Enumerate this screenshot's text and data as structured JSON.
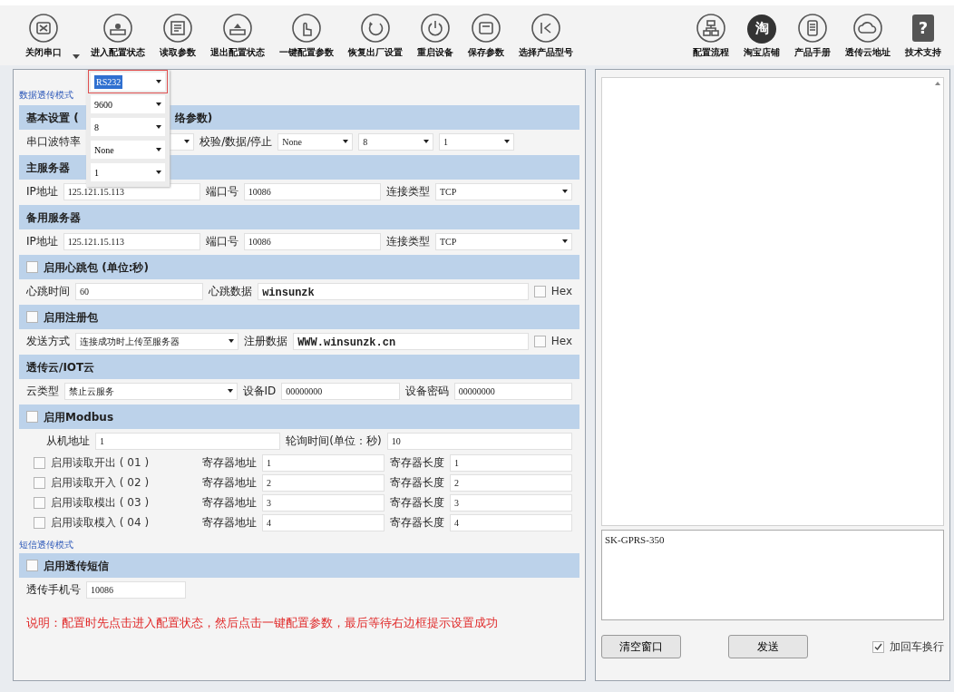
{
  "toolbar_left": [
    {
      "label": "关闭串口"
    },
    {
      "label": "进入配置状态"
    },
    {
      "label": "读取参数"
    },
    {
      "label": "退出配置状态"
    },
    {
      "label": "一键配置参数"
    },
    {
      "label": "恢复出厂设置"
    },
    {
      "label": "重启设备"
    },
    {
      "label": "保存参数"
    },
    {
      "label": "选择产品型号"
    }
  ],
  "toolbar_right": [
    {
      "label": "配置流程"
    },
    {
      "label": "淘宝店铺",
      "glyph": "淘"
    },
    {
      "label": "产品手册"
    },
    {
      "label": "透传云地址"
    },
    {
      "label": "技术支持",
      "glyph": "?"
    }
  ],
  "mode_label": "数据透传模式",
  "popup": {
    "items": [
      {
        "text": "RS232",
        "selected": true
      },
      {
        "text": "9600",
        "selected": false
      },
      {
        "text": "8",
        "selected": false
      },
      {
        "text": "None",
        "selected": false
      },
      {
        "text": "1",
        "selected": false
      }
    ]
  },
  "sections": [
    {
      "title": "基本设置 (",
      "tail": "络参数)",
      "rows": [
        [
          {
            "kind": "label",
            "text": "串口波特率"
          },
          {
            "kind": "combo"
          },
          {
            "kind": "label",
            "text": "校验/数据/停止"
          },
          {
            "kind": "combo",
            "value": "None"
          },
          {
            "kind": "combo",
            "value": "8"
          },
          {
            "kind": "combo",
            "value": "1"
          },
          {
            "kind": "gap"
          }
        ]
      ]
    },
    {
      "title": "主服务器",
      "rows": [
        [
          {
            "kind": "label",
            "text": "IP地址"
          },
          {
            "kind": "input",
            "value": "125.121.15.113"
          },
          {
            "kind": "label",
            "text": "端口号"
          },
          {
            "kind": "input",
            "value": "10086"
          },
          {
            "kind": "label",
            "text": "连接类型"
          },
          {
            "kind": "combo",
            "value": "TCP"
          }
        ]
      ]
    },
    {
      "title": "备用服务器",
      "rows": [
        [
          {
            "kind": "label",
            "text": "IP地址"
          },
          {
            "kind": "input",
            "value": "125.121.15.113"
          },
          {
            "kind": "label",
            "text": "端口号"
          },
          {
            "kind": "input",
            "value": "10086"
          },
          {
            "kind": "label",
            "text": "连接类型"
          },
          {
            "kind": "combo",
            "value": "TCP"
          }
        ]
      ]
    },
    {
      "title": "启用心跳包 (单位:秒)",
      "checked": false,
      "rows": [
        [
          {
            "kind": "label",
            "text": "心跳时间"
          },
          {
            "kind": "input",
            "value": "60"
          },
          {
            "kind": "label",
            "text": "心跳数据"
          },
          {
            "kind": "code_input",
            "value": "winsunzk"
          },
          {
            "kind": "check",
            "text": "Hex",
            "checked": false
          }
        ]
      ]
    },
    {
      "title": "启用注册包",
      "checked": false,
      "rows": [
        [
          {
            "kind": "label",
            "text": "发送方式"
          },
          {
            "kind": "combo",
            "value": "连接成功时上传至服务器"
          },
          {
            "kind": "label",
            "text": "注册数据"
          },
          {
            "kind": "code_input",
            "value": "WWW.winsunzk.cn"
          },
          {
            "kind": "check",
            "text": "Hex",
            "checked": false
          }
        ]
      ]
    },
    {
      "title": "透传云/IOT云",
      "rows": [
        [
          {
            "kind": "label",
            "text": "云类型"
          },
          {
            "kind": "combo",
            "value": "禁止云服务"
          },
          {
            "kind": "label",
            "text": "设备ID"
          },
          {
            "kind": "input",
            "value": "00000000"
          },
          {
            "kind": "label",
            "text": "设备密码"
          },
          {
            "kind": "input",
            "value": "00000000"
          }
        ]
      ]
    },
    {
      "title": "启用Modbus",
      "checked": false,
      "rows": [
        [
          {
            "kind": "label",
            "text": "从机地址"
          },
          {
            "kind": "input",
            "value": "1"
          },
          {
            "kind": "label",
            "text": "轮询时间(单位：秒)"
          },
          {
            "kind": "input",
            "value": "10"
          }
        ]
      ],
      "registers": [
        {
          "label": "启用读取开出 ( 01 )",
          "checked": false,
          "address_label": "寄存器地址",
          "address": "1",
          "length_label": "寄存器长度",
          "length": "1"
        },
        {
          "label": "启用读取开入 ( 02 )",
          "checked": false,
          "address_label": "寄存器地址",
          "address": "2",
          "length_label": "寄存器长度",
          "length": "2"
        },
        {
          "label": "启用读取模出 ( 03 )",
          "checked": false,
          "address_label": "寄存器地址",
          "address": "3",
          "length_label": "寄存器长度",
          "length": "3"
        },
        {
          "label": "启用读取模入 ( 04 )",
          "checked": false,
          "address_label": "寄存器地址",
          "address": "4",
          "length_label": "寄存器长度",
          "length": "4"
        }
      ]
    },
    {
      "kind": "caption",
      "text": "短信透传模式"
    },
    {
      "title": "启用透传短信",
      "checked": false,
      "rows": [
        [
          {
            "kind": "label",
            "text": "透传手机号"
          },
          {
            "kind": "input",
            "value": "10086"
          },
          {
            "kind": "gap"
          }
        ]
      ]
    }
  ],
  "note": "说明：配置时先点击进入配置状态，然后点击一键配置参数，最后等待右边框提示设置成功",
  "log_text": "SK-GPRS-350",
  "buttons": [
    {
      "label": "清空窗口"
    },
    {
      "label": "发送"
    }
  ],
  "crlf": {
    "label": "加回车换行",
    "checked": true
  }
}
